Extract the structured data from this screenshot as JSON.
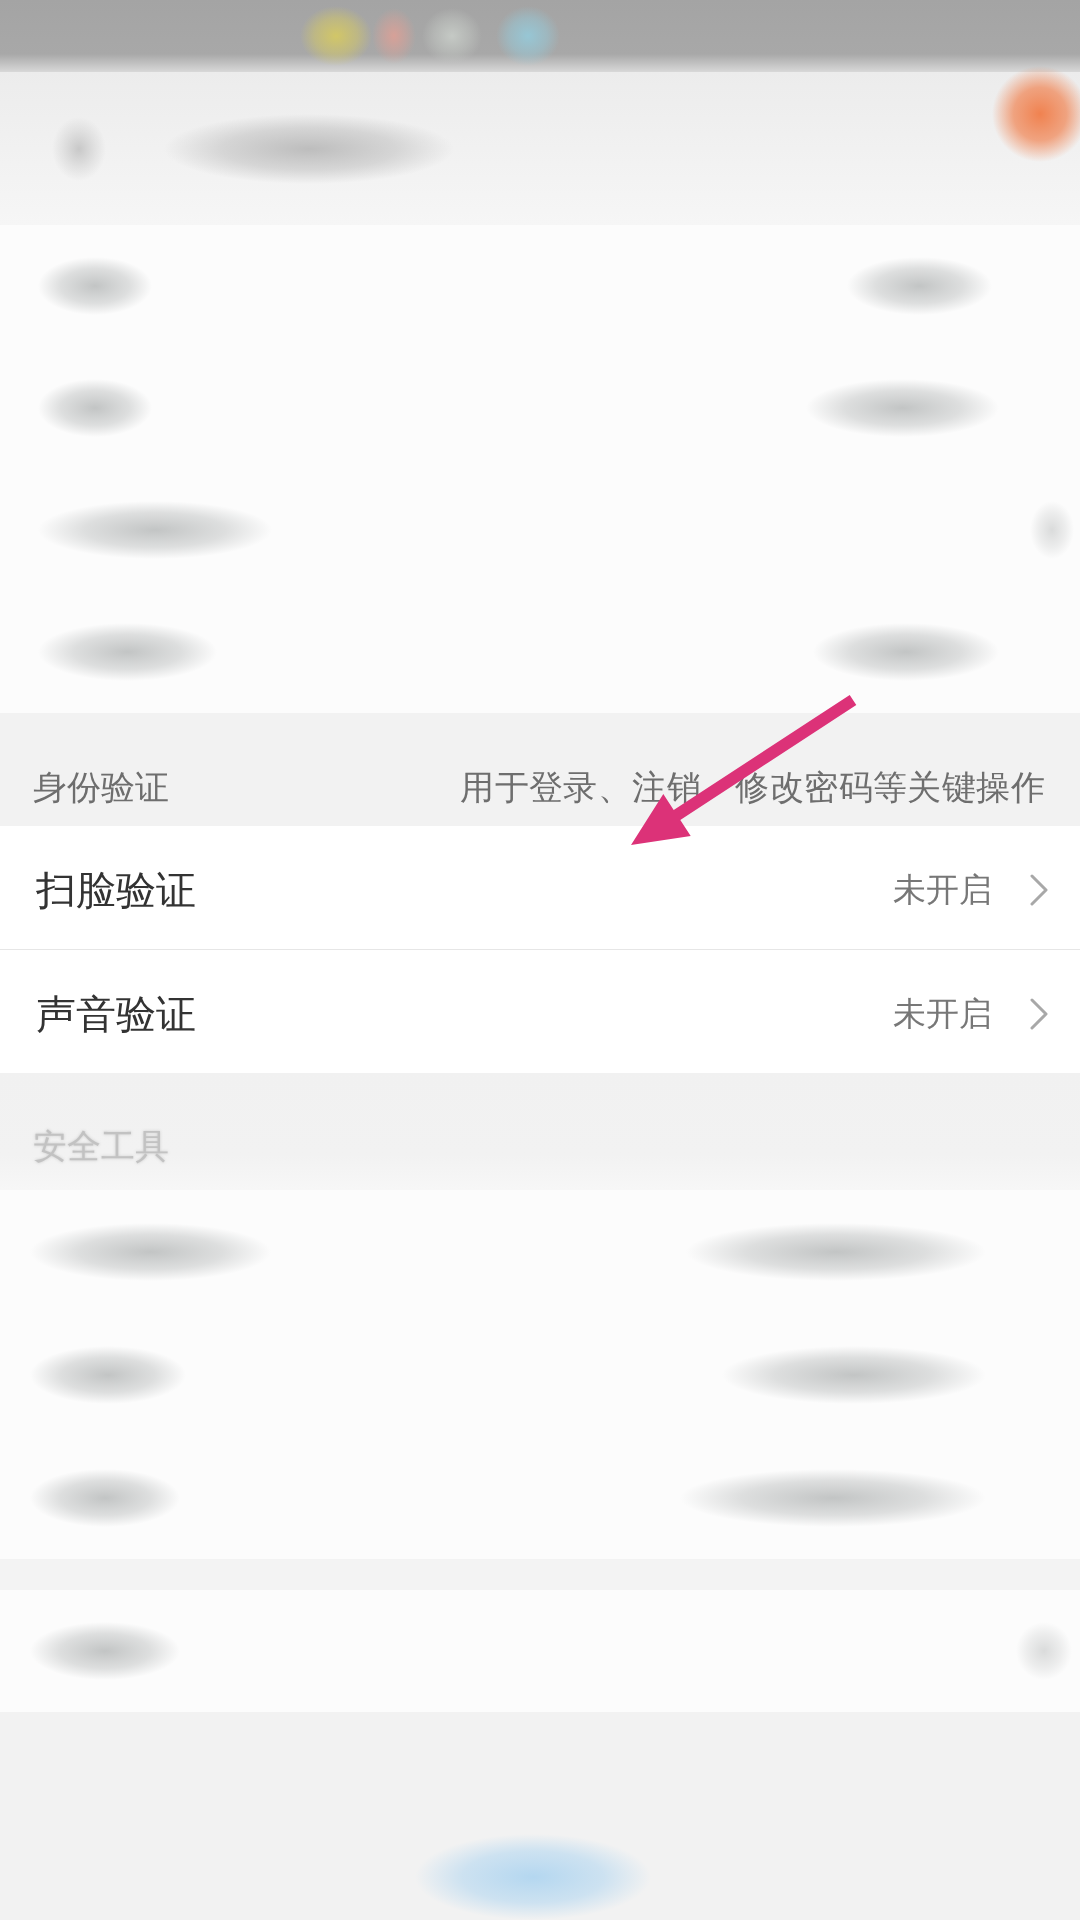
{
  "identity_section": {
    "title": "身份验证",
    "description_parts": [
      "用于登录、注销",
      "修改密码等关键操作"
    ]
  },
  "identity_rows": [
    {
      "label": "扫脸验证",
      "value": "未开启"
    },
    {
      "label": "声音验证",
      "value": "未开启"
    }
  ],
  "tools_section": {
    "title": "安全工具"
  }
}
